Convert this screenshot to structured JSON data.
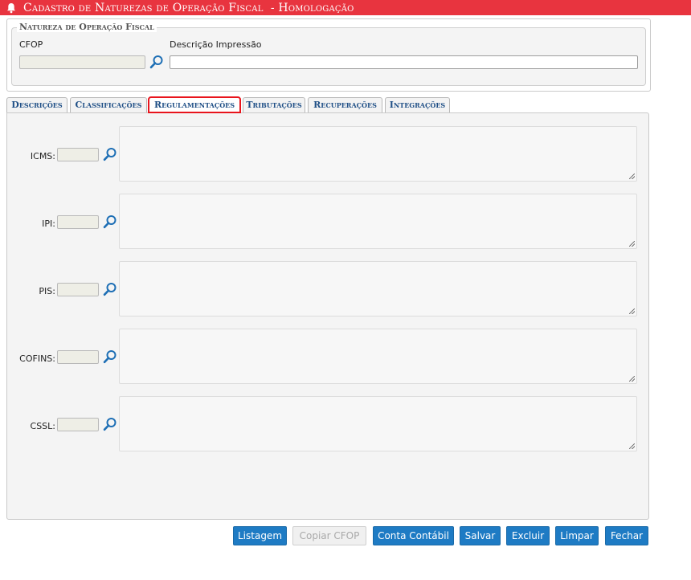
{
  "window": {
    "title": "Cadastro de Naturezas de Operação Fiscal  - Homologação",
    "icon": "bell-icon",
    "accent_color": "#e8343f"
  },
  "natureza": {
    "legend": "Natureza de Operação Fiscal",
    "cfop_label": "CFOP",
    "cfop_value": "",
    "descricao_label": "Descrição Impressão",
    "descricao_value": ""
  },
  "tabs": [
    {
      "label": "Descrições",
      "active": false
    },
    {
      "label": "Classificações",
      "active": false
    },
    {
      "label": "Regulamentações",
      "active": true
    },
    {
      "label": "Tributações",
      "active": false
    },
    {
      "label": "Recuperações",
      "active": false
    },
    {
      "label": "Integrações",
      "active": false
    }
  ],
  "regulamentacoes": [
    {
      "label": "ICMS:",
      "code": "",
      "text": ""
    },
    {
      "label": "IPI:",
      "code": "",
      "text": ""
    },
    {
      "label": "PIS:",
      "code": "",
      "text": ""
    },
    {
      "label": "COFINS:",
      "code": "",
      "text": ""
    },
    {
      "label": "CSSL:",
      "code": "",
      "text": ""
    }
  ],
  "buttons": {
    "listagem": "Listagem",
    "copiar_cfop": "Copiar CFOP",
    "conta_contabil": "Conta Contábil",
    "salvar": "Salvar",
    "excluir": "Excluir",
    "limpar": "Limpar",
    "fechar": "Fechar",
    "color": "#1e7bc4"
  }
}
